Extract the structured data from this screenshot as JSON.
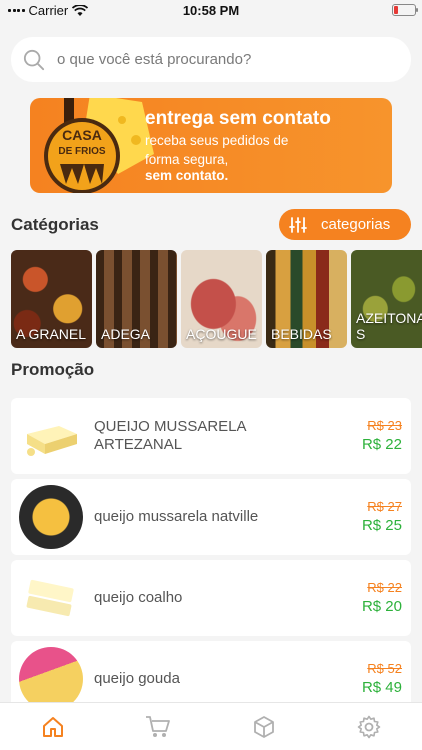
{
  "status": {
    "carrier": "Carrier",
    "time": "10:58 PM"
  },
  "search": {
    "placeholder": "o que você está procurando?"
  },
  "banner": {
    "logo_text": "CASA DE FRIOS",
    "title": "entrega sem contato",
    "subtitle_line1": "receba seus pedidos de",
    "subtitle_line2": "forma segura,",
    "bold_line": "sem contato."
  },
  "categories": {
    "title": "Catégorias",
    "button_label": "categorias",
    "items": [
      {
        "label": "A GRANEL",
        "color": "#6b3a1f"
      },
      {
        "label": "ADEGA",
        "color": "#5a3a22"
      },
      {
        "label": "AÇOUGUE",
        "color": "#b8605a"
      },
      {
        "label": "BEBIDAS",
        "color": "#8a5a2a"
      },
      {
        "label": "AZEITONAS",
        "color": "#6e7a2a"
      }
    ]
  },
  "promo": {
    "title": "Promoção",
    "items": [
      {
        "name": "QUEIJO MUSSARELA ARTEZANAL",
        "old_price": "R$ 23",
        "new_price": "R$ 22"
      },
      {
        "name": "queijo mussarela natville",
        "old_price": "R$ 27",
        "new_price": "R$ 25"
      },
      {
        "name": "queijo coalho",
        "old_price": "R$ 22",
        "new_price": "R$ 20"
      },
      {
        "name": "queijo gouda",
        "old_price": "R$ 52",
        "new_price": "R$ 49"
      }
    ]
  },
  "tabbar": {
    "items": [
      "home-icon",
      "cart-icon",
      "box-icon",
      "gear-icon"
    ],
    "active_color": "#f58220",
    "inactive_color": "#b0b0b0"
  },
  "colors": {
    "accent": "#f58220",
    "price_green": "#2db13b"
  }
}
